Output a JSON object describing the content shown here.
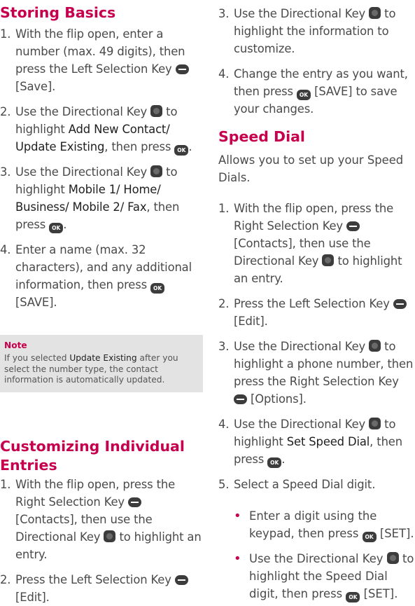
{
  "left": {
    "section1": {
      "title": "Storing Basics",
      "items": [
        {
          "num": "1.",
          "a": "With the flip open, enter a number (max. 49 digits), then press the Left Selection Key ",
          "b": " [Save]."
        },
        {
          "num": "2.",
          "a": "Use the Directional Key ",
          "b": " to highlight ",
          "c": "Add New Contact/ Update Existing",
          "d": ", then press ",
          "e": "."
        },
        {
          "num": "3.",
          "a": "Use the Directional Key ",
          "b": " to highlight ",
          "c": "Mobile 1/ Home/ Business/ Mobile 2/ Fax",
          "d": ", then press ",
          "e": "."
        },
        {
          "num": "4.",
          "a": "Enter a name (max. 32 characters), and any additional information, then press ",
          "b": " [SAVE]."
        }
      ]
    },
    "note": {
      "title": "Note",
      "a": "If you selected ",
      "b": "Update Existing",
      "c": " after you select the number type, the contact information is automatically updated."
    },
    "section2": {
      "title": "Customizing Individual Entries",
      "items": [
        {
          "num": "1.",
          "a": "With the flip open, press the Right Selection Key ",
          "b": " [Contacts], then use the Directional Key ",
          "c": " to highlight an entry."
        },
        {
          "num": "2.",
          "a": "Press the Left Selection Key ",
          "b": " [Edit]."
        }
      ]
    }
  },
  "right": {
    "cont_items": [
      {
        "num": "3.",
        "a": "Use the Directional Key ",
        "b": " to highlight the information to customize."
      },
      {
        "num": "4.",
        "a": "Change the entry as you want, then press ",
        "b": " [SAVE] to save your changes."
      }
    ],
    "section3": {
      "title": "Speed Dial",
      "desc": "Allows you to set up your Speed Dials.",
      "items": [
        {
          "num": "1.",
          "a": "With the flip open, press the Right Selection Key ",
          "b": " [Contacts], then use the Directional Key ",
          "c": " to highlight an entry."
        },
        {
          "num": "2.",
          "a": "Press the Left Selection Key ",
          "b": " [Edit]."
        },
        {
          "num": "3.",
          "a": "Use the Directional Key ",
          "b": " to highlight a phone number, then press the Right Selection Key ",
          "c": " [Options]."
        },
        {
          "num": "4.",
          "a": "Use the Directional Key ",
          "b": " to highlight ",
          "c": "Set Speed Dial",
          "d": ", then press ",
          "e": "."
        },
        {
          "num": "5.",
          "a": "Select a Speed Dial digit."
        }
      ],
      "bullets": [
        {
          "a": "Enter a digit using the keypad, then press ",
          "b": " [SET]."
        },
        {
          "a": "Use the Directional Key ",
          "b": " to highlight the Speed Dial digit, then press ",
          "c": " [SET]."
        }
      ]
    }
  },
  "icons": {
    "ok_label": "OK"
  }
}
